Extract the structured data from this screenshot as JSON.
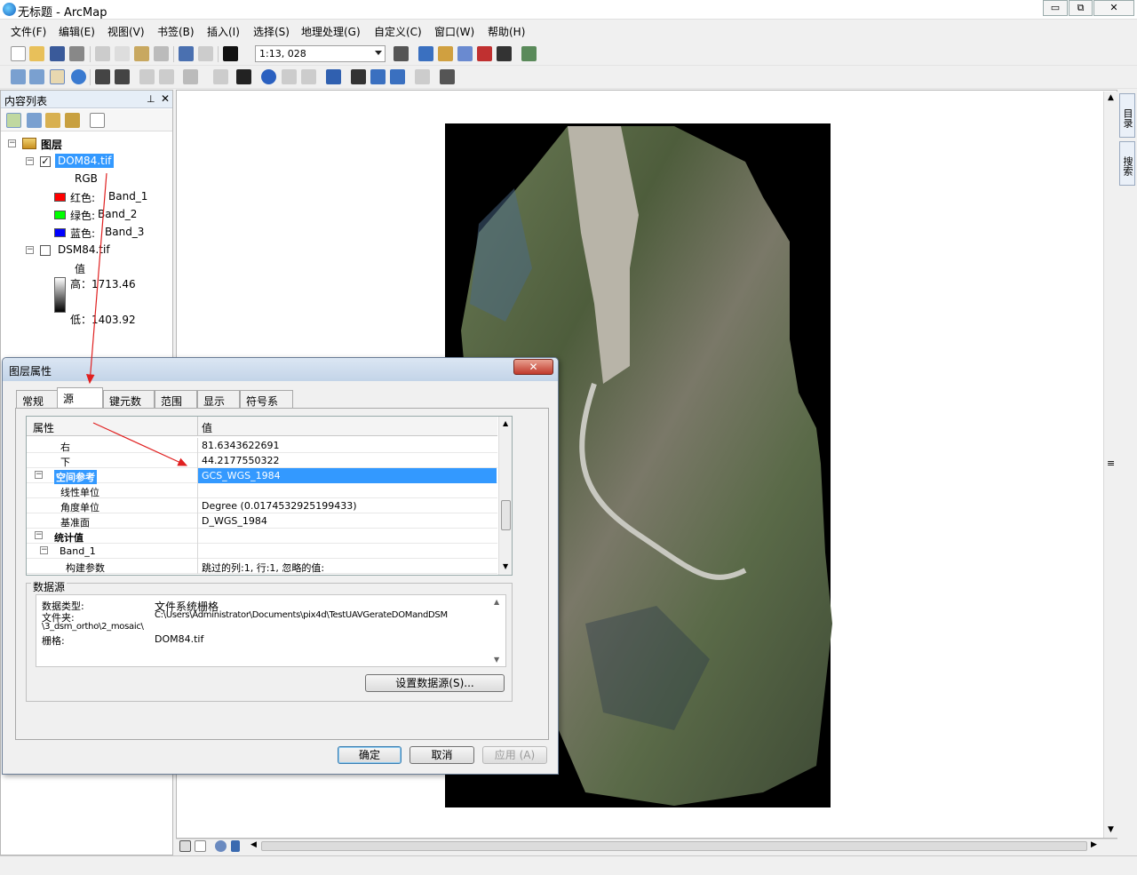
{
  "window": {
    "title": "无标题 - ArcMap",
    "minimize": "▭",
    "restore": "⧉",
    "close": "✕"
  },
  "menubar": [
    "文件(F)",
    "编辑(E)",
    "视图(V)",
    "书签(B)",
    "插入(I)",
    "选择(S)",
    "地理处理(G)",
    "自定义(C)",
    "窗口(W)",
    "帮助(H)"
  ],
  "toolbar": {
    "scale": "1:13, 028"
  },
  "toc": {
    "title": "内容列表",
    "pin_icon": "pin-icon",
    "close_icon": "close-icon",
    "root": "图层",
    "layers": [
      {
        "name": "DOM84.tif",
        "checked": true,
        "selected": true,
        "renderer": "RGB",
        "bands": [
          {
            "label": "红色:",
            "band": "Band_1",
            "color": "#ff0000"
          },
          {
            "label": "绿色:",
            "band": "Band_2",
            "color": "#00ff00"
          },
          {
            "label": "蓝色:",
            "band": "Band_3",
            "color": "#0000ff"
          }
        ]
      },
      {
        "name": "DSM84.tif",
        "checked": false,
        "value_label": "值",
        "high": "高：1713.46",
        "low": "低：1403.92"
      }
    ]
  },
  "right_panel": {
    "tabs": [
      "目录",
      "搜索"
    ]
  },
  "dialog": {
    "title": "图层属性",
    "close": "✕",
    "tabs": [
      "常规",
      "源",
      "键元数据",
      "范围",
      "显示",
      "符号系统"
    ],
    "active_tab": "源",
    "grid": {
      "headers": [
        "属性",
        "值"
      ],
      "rows": [
        {
          "key": "右",
          "value": "81.6343622691"
        },
        {
          "key": "下",
          "value": "44.2177550322"
        },
        {
          "key": "空间参考",
          "value": "GCS_WGS_1984",
          "group": true,
          "selected": true
        },
        {
          "key": "线性单位",
          "value": ""
        },
        {
          "key": "角度单位",
          "value": "Degree (0.0174532925199433)"
        },
        {
          "key": "基准面",
          "value": "D_WGS_1984"
        },
        {
          "key": "统计值",
          "value": "",
          "group": true
        },
        {
          "key": "Band_1",
          "value": "",
          "sub": true
        },
        {
          "key": "构建参数",
          "value": "跳过的列:1, 行:1, 忽略的值:"
        }
      ]
    },
    "datasource": {
      "legend": "数据源",
      "type_label": "数据类型:",
      "type_value": "文件系统栅格",
      "folder_label": "文件夹:",
      "folder_value": "C:\\Users\\Administrator\\Documents\\pix4d\\TestUAVGerateDOMandDSM",
      "folder_value2": "\\3_dsm_ortho\\2_mosaic\\",
      "raster_label": "栅格:",
      "raster_value": "DOM84.tif"
    },
    "set_source_button": "设置数据源(S)...",
    "ok": "确定",
    "cancel": "取消",
    "apply": "应用 (A)"
  }
}
